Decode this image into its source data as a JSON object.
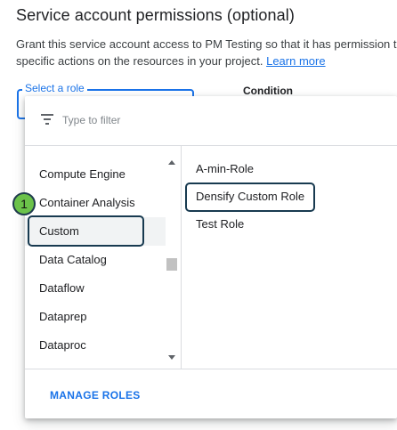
{
  "section": {
    "title": "Service account permissions (optional)",
    "description_line1": "Grant this service account access to PM Testing so that it has permission to",
    "description_line2": "specific actions on the resources in your project. ",
    "learn_more": "Learn more"
  },
  "role_field": {
    "label": "Select a role"
  },
  "condition": {
    "label": "Condition"
  },
  "filter": {
    "placeholder": "Type to filter",
    "value": ""
  },
  "categories": [
    {
      "label": "Compute Engine"
    },
    {
      "label": "Container Analysis"
    },
    {
      "label": "Custom"
    },
    {
      "label": "Data Catalog"
    },
    {
      "label": "Dataflow"
    },
    {
      "label": "Dataprep"
    },
    {
      "label": "Dataproc"
    }
  ],
  "selected_category": "Custom",
  "roles": [
    {
      "label": "A-min-Role"
    },
    {
      "label": "Densify Custom Role"
    },
    {
      "label": "Test Role"
    }
  ],
  "manage_roles_label": "MANAGE ROLES",
  "annotation": {
    "step_number": "1",
    "color": "#6bc24a",
    "outline_color": "#183a50"
  },
  "colors": {
    "accent": "#1a73e8",
    "selected_bg": "#f1f3f4"
  },
  "icons": {
    "filter": "filter-list-icon",
    "scroll_up": "arrow-up-icon",
    "scroll_down": "arrow-down-icon"
  }
}
